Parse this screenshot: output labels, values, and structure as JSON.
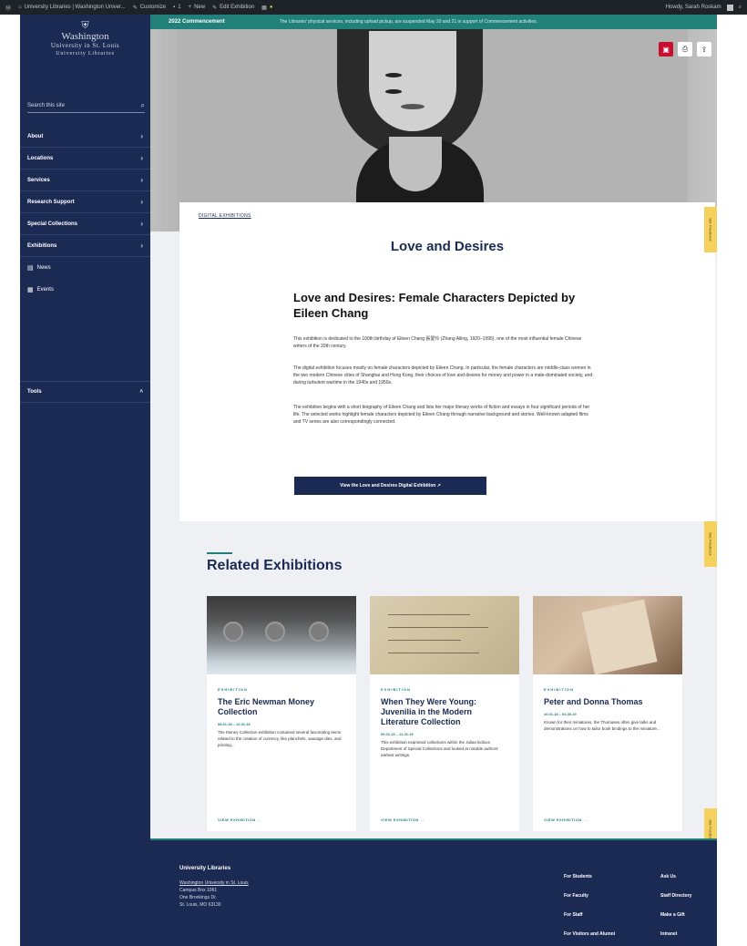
{
  "admin_bar": {
    "site": "University Libraries | Washington Univer...",
    "customize": "Customize",
    "comments": "1",
    "new": "New",
    "edit": "Edit Exhibition",
    "howdy": "Howdy, Sarah Roskam"
  },
  "sidebar": {
    "logo": {
      "line1": "Washington",
      "line2": "University in St. Louis",
      "line3": "University Libraries"
    },
    "search_placeholder": "Search this site",
    "nav": [
      {
        "label": "About"
      },
      {
        "label": "Locations"
      },
      {
        "label": "Services"
      },
      {
        "label": "Research Support"
      },
      {
        "label": "Special Collections"
      },
      {
        "label": "Exhibitions"
      }
    ],
    "links": [
      {
        "label": "News"
      },
      {
        "label": "Events"
      }
    ],
    "tools": "Tools"
  },
  "topbar": {
    "title": "2022 Commencement",
    "notice": "The Libraries' physical services, including upload pickup, are suspended May 20 and 21 in support of Commencement activities."
  },
  "exhibit": {
    "breadcrumb": "DIGITAL EXHIBITIONS",
    "title": "Love and Desires",
    "subtitle": "Love and Desires: Female Characters Depicted by Eileen Chang",
    "p1": "This exhibition is dedicated to the 100th birthday of Eileen Chang 張愛玲 (Zhang Ailing, 1920–1995), one of the most influential female Chinese writers of the 20th century.",
    "p2": "The digital exhibition focuses mostly on female characters depicted by Eileen Chang. In particular, the female characters are middle-class women in the two modern Chinese cities of Shanghai and Hong Kong, their choices of love and desires for money and power in a male-dominated society, and during turbulent wartime in the 1940s and 1950s.",
    "p3": "The exhibition begins with a short biography of Eileen Chang and lists her major literary works of fiction and essays in four significant periods of her life. The selected works highlight female characters depicted by Eileen Chang through narrative background and stories. Well-known adapted films and TV series are also correspondingly connected.",
    "button": "View the Love and Desires Digital Exhibition ↗"
  },
  "related": {
    "heading": "Related Exhibitions",
    "items": [
      {
        "type": "EXHIBITION",
        "title": "The Eric Newman Money Collection",
        "dates": "08.01.18 – 12.31.18",
        "desc": "The Money Collection exhibition contained several fascinating items related to the creation of currency, like planchets, sausage dies, and printing...",
        "view": "VIEW EXHIBITION →"
      },
      {
        "type": "EXHIBITION",
        "title": "When They Were Young: Juvenilia in the Modern Literature Collection",
        "dates": "06.01.19 – 12.31.19",
        "desc": "This exhibition examined collections within the Julian Edison Department of Special Collections and looked at notable authors' earliest writings.",
        "view": "VIEW EXHIBITION →"
      },
      {
        "type": "EXHIBITION",
        "title": "Peter and Donna Thomas",
        "dates": "10.01.18 – 04.30.19",
        "desc": "Known for their miniatures, the Thomases often give talks and demonstrations on how to tailor book bindings to the miniature...",
        "view": "VIEW EXHIBITION →"
      }
    ]
  },
  "feedback_tab": "Site Feedback",
  "footer": {
    "title": "University Libraries",
    "addr1": "Washington University in St. Louis",
    "addr2": "Campus Box 1061",
    "addr3": "One Brookings Dr.",
    "addr4": "St. Louis, MO 63130",
    "links_col1": [
      "For Students",
      "For Faculty",
      "For Staff",
      "For Visitors and Alumni"
    ],
    "links_col2": [
      "Ask Us",
      "Staff Directory",
      "Make a Gift",
      "Intranet"
    ]
  }
}
